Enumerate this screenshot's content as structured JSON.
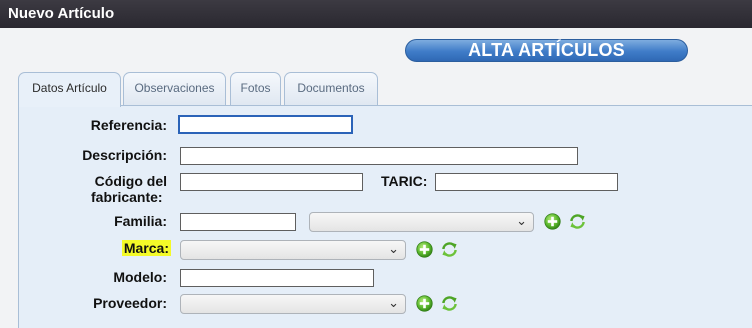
{
  "window": {
    "title": "Nuevo Artículo"
  },
  "header": {
    "title": "ALTA ARTÍCULOS"
  },
  "tabs": [
    {
      "label": "Datos Artículo",
      "active": true
    },
    {
      "label": "Observaciones",
      "active": false
    },
    {
      "label": "Fotos",
      "active": false
    },
    {
      "label": "Documentos",
      "active": false
    }
  ],
  "form": {
    "referencia": {
      "label": "Referencia:",
      "value": ""
    },
    "descripcion": {
      "label": "Descripción:",
      "value": ""
    },
    "codigo_fabricante": {
      "label_line1": "Código del",
      "label_line2": "fabricante:",
      "value": ""
    },
    "taric": {
      "label": "TARIC:",
      "value": ""
    },
    "familia": {
      "label": "Familia:",
      "value": "",
      "select_value": ""
    },
    "marca": {
      "label": "Marca:",
      "select_value": "",
      "highlighted": true
    },
    "modelo": {
      "label": "Modelo:",
      "value": ""
    },
    "proveedor": {
      "label": "Proveedor:",
      "select_value": ""
    }
  },
  "icons": {
    "add": "add-circle-icon",
    "refresh": "refresh-arrows-icon",
    "chevron": "chevron-down-icon"
  },
  "colors": {
    "titlebar": "#2a2830",
    "banner": "#3f7cc8",
    "panel": "#e5eef8",
    "highlight": "#f4fa28",
    "add_green": "#5bb82e"
  }
}
